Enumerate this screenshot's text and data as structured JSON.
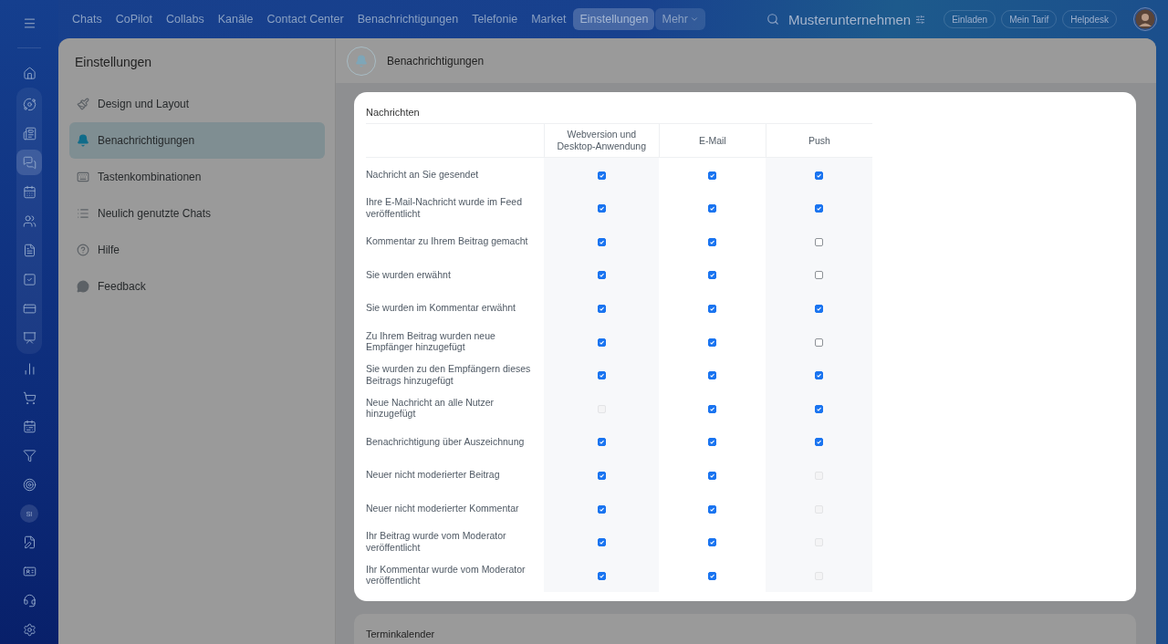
{
  "topnav": {
    "items": [
      {
        "label": "Chats",
        "selected": false,
        "kind": "link"
      },
      {
        "label": "CoPilot",
        "selected": false,
        "kind": "link"
      },
      {
        "label": "Collabs",
        "selected": false,
        "kind": "link"
      },
      {
        "label": "Kanäle",
        "selected": false,
        "kind": "link"
      },
      {
        "label": "Contact Center",
        "selected": false,
        "kind": "link"
      },
      {
        "label": "Benachrichtigungen",
        "selected": false,
        "kind": "link"
      },
      {
        "label": "Telefonie",
        "selected": false,
        "kind": "link"
      },
      {
        "label": "Market",
        "selected": false,
        "kind": "link"
      },
      {
        "label": "Einstellungen",
        "selected": true,
        "kind": "link"
      },
      {
        "label": "Mehr",
        "selected": false,
        "kind": "dropdown"
      }
    ],
    "company": "Musterunternehmen",
    "buttons": [
      "Einladen",
      "Mein Tarif",
      "Helpdesk"
    ]
  },
  "rail": {
    "top": [
      {
        "selected": false
      }
    ],
    "group": [
      {
        "selected": false
      },
      {
        "selected": false
      },
      {
        "selected": true
      },
      {
        "selected": false
      },
      {
        "selected": false
      },
      {
        "selected": false
      },
      {
        "selected": false
      },
      {
        "selected": false
      },
      {
        "selected": false
      }
    ],
    "bottom": [
      {
        "selected": false
      },
      {
        "selected": false
      },
      {
        "selected": false
      },
      {
        "selected": false
      },
      {
        "selected": false
      },
      {
        "selected": false,
        "label": "SI"
      },
      {
        "selected": false
      },
      {
        "selected": false
      },
      {
        "selected": false
      },
      {
        "selected": false
      }
    ]
  },
  "settings": {
    "title": "Einstellungen",
    "items": [
      {
        "label": "Design und Layout",
        "selected": false
      },
      {
        "label": "Benachrichtigungen",
        "selected": true
      },
      {
        "label": "Tastenkombinationen",
        "selected": false
      },
      {
        "label": "Neulich genutzte Chats",
        "selected": false
      },
      {
        "label": "Hilfe",
        "selected": false
      },
      {
        "label": "Feedback",
        "selected": false
      }
    ]
  },
  "content": {
    "title": "Benachrichtigungen"
  },
  "messages": {
    "title": "Nachrichten",
    "columns": [
      "Webversion und Desktop-Anwendung",
      "E-Mail",
      "Push"
    ],
    "rows": [
      {
        "label": "Nachricht an Sie gesendet",
        "cells": [
          {
            "checked": true,
            "disabled": false
          },
          {
            "checked": true,
            "disabled": false
          },
          {
            "checked": true,
            "disabled": false
          }
        ]
      },
      {
        "label": "Ihre E-Mail-Nachricht wurde im Feed veröffentlicht",
        "cells": [
          {
            "checked": true,
            "disabled": false
          },
          {
            "checked": true,
            "disabled": false
          },
          {
            "checked": true,
            "disabled": false
          }
        ]
      },
      {
        "label": "Kommentar zu Ihrem Beitrag gemacht",
        "cells": [
          {
            "checked": true,
            "disabled": false
          },
          {
            "checked": true,
            "disabled": false
          },
          {
            "checked": false,
            "disabled": false
          }
        ]
      },
      {
        "label": "Sie wurden erwähnt",
        "cells": [
          {
            "checked": true,
            "disabled": false
          },
          {
            "checked": true,
            "disabled": false
          },
          {
            "checked": false,
            "disabled": false
          }
        ]
      },
      {
        "label": "Sie wurden im Kommentar erwähnt",
        "cells": [
          {
            "checked": true,
            "disabled": false
          },
          {
            "checked": true,
            "disabled": false
          },
          {
            "checked": true,
            "disabled": false
          }
        ]
      },
      {
        "label": "Zu Ihrem Beitrag wurden neue Empfänger hinzugefügt",
        "cells": [
          {
            "checked": true,
            "disabled": false
          },
          {
            "checked": true,
            "disabled": false
          },
          {
            "checked": false,
            "disabled": false
          }
        ]
      },
      {
        "label": "Sie wurden zu den Empfängern dieses Beitrags hinzugefügt",
        "cells": [
          {
            "checked": true,
            "disabled": false
          },
          {
            "checked": true,
            "disabled": false
          },
          {
            "checked": true,
            "disabled": false
          }
        ]
      },
      {
        "label": "Neue Nachricht an alle Nutzer hinzugefügt",
        "cells": [
          {
            "checked": false,
            "disabled": true
          },
          {
            "checked": true,
            "disabled": false
          },
          {
            "checked": true,
            "disabled": false
          }
        ]
      },
      {
        "label": "Benachrichtigung über Auszeichnung",
        "cells": [
          {
            "checked": true,
            "disabled": false
          },
          {
            "checked": true,
            "disabled": false
          },
          {
            "checked": true,
            "disabled": false
          }
        ]
      },
      {
        "label": "Neuer nicht moderierter Beitrag",
        "cells": [
          {
            "checked": true,
            "disabled": false
          },
          {
            "checked": true,
            "disabled": false
          },
          {
            "checked": false,
            "disabled": true
          }
        ]
      },
      {
        "label": "Neuer nicht moderierter Kommentar",
        "cells": [
          {
            "checked": true,
            "disabled": false
          },
          {
            "checked": true,
            "disabled": false
          },
          {
            "checked": false,
            "disabled": true
          }
        ]
      },
      {
        "label": "Ihr Beitrag wurde vom Moderator veröffentlicht",
        "cells": [
          {
            "checked": true,
            "disabled": false
          },
          {
            "checked": true,
            "disabled": false
          },
          {
            "checked": false,
            "disabled": true
          }
        ]
      },
      {
        "label": "Ihr Kommentar wurde vom Moderator veröffentlicht",
        "cells": [
          {
            "checked": true,
            "disabled": false
          },
          {
            "checked": true,
            "disabled": false
          },
          {
            "checked": false,
            "disabled": true
          }
        ]
      }
    ]
  },
  "next_section": {
    "title": "Terminkalender"
  }
}
